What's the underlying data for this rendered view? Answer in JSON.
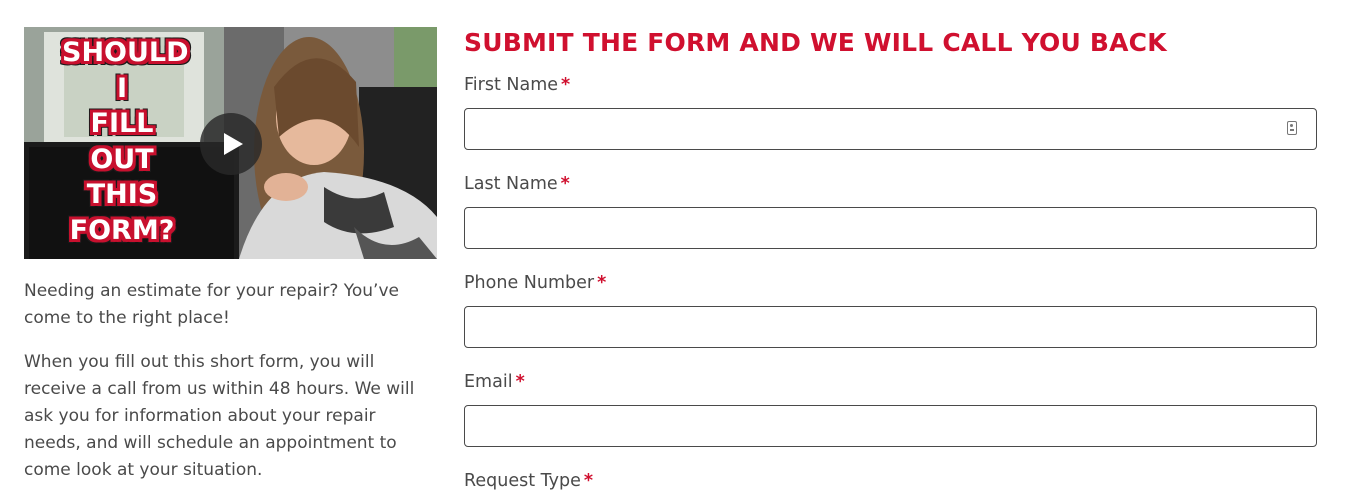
{
  "video": {
    "overlay_lines": [
      "SHOULD",
      "I",
      "FILL",
      "OUT",
      "THIS",
      "FORM?"
    ],
    "play_icon": "play-icon"
  },
  "intro": {
    "paragraph_1": "Needing an estimate for your repair? You’ve come to the right place!",
    "paragraph_2": "When you fill out this short form, you will receive a call from us within 48 hours. We will ask you for information about your repair needs, and will schedule an appointment to come look at your situation."
  },
  "form": {
    "title": "SUBMIT THE FORM AND WE WILL CALL YOU BACK",
    "required_marker": "*",
    "fields": [
      {
        "label": "First Name",
        "value": "",
        "autofill_icon": "contact-card-icon"
      },
      {
        "label": "Last Name",
        "value": ""
      },
      {
        "label": "Phone Number",
        "value": ""
      },
      {
        "label": "Email",
        "value": ""
      }
    ],
    "request_type_label": "Request Type"
  },
  "colors": {
    "accent": "#d0102f",
    "text": "#4a4a4a",
    "border": "#4a4a4a"
  }
}
